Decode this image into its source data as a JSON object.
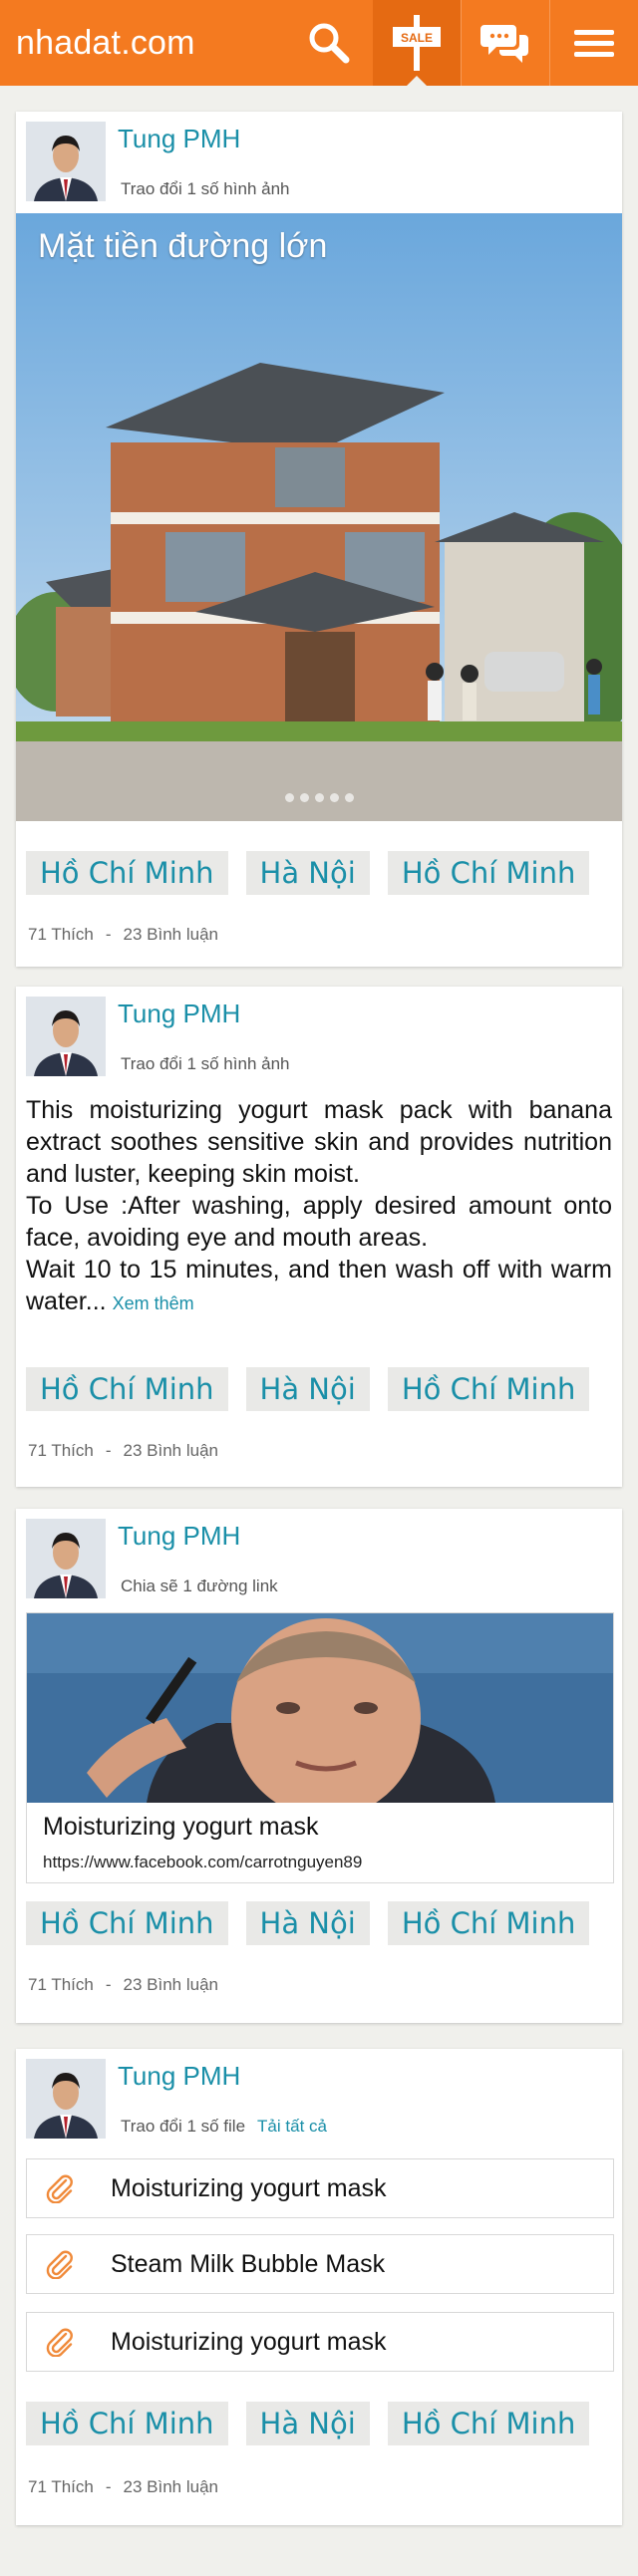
{
  "header": {
    "logo": "nhadat.com",
    "sale_badge": "SALE"
  },
  "colors": {
    "brand": "#f47a20",
    "accent": "#1a8fa8"
  },
  "icons": [
    "search-icon",
    "sale-sign-icon",
    "chat-icon",
    "menu-icon",
    "paperclip-icon"
  ],
  "posts": [
    {
      "author": "Tung PMH",
      "subtitle": "Trao đổi 1 số hình ảnh",
      "hero_title": "Mặt tiền đường lớn",
      "slides": 5,
      "tags": [
        "Hồ Chí Minh",
        "Hà Nội",
        "Hồ Chí Minh"
      ],
      "likes": "71 Thích",
      "separator": "-",
      "comments": "23 Bình luận"
    },
    {
      "author": "Tung PMH",
      "subtitle": "Trao đổi 1 số hình ảnh",
      "body": "This moisturizing yogurt mask pack with banana extract soothes sensitive skin and provides nutrition and luster, keeping skin moist.\nTo Use :After washing, apply desired amount onto face, avoiding eye and mouth areas.\nWait 10 to 15 minutes, and then wash off with warm water...",
      "more": "Xem thêm",
      "tags": [
        "Hồ Chí Minh",
        "Hà Nội",
        "Hồ Chí Minh"
      ],
      "likes": "71 Thích",
      "separator": "-",
      "comments": "23 Bình luận"
    },
    {
      "author": "Tung PMH",
      "subtitle": "Chia sẽ 1 đường link",
      "link_title": "Moisturizing yogurt mask",
      "link_url": "https://www.facebook.com/carrotnguyen89",
      "tags": [
        "Hồ Chí Minh",
        "Hà Nội",
        "Hồ Chí Minh"
      ],
      "likes": "71 Thích",
      "separator": "-",
      "comments": "23 Bình luận"
    },
    {
      "author": "Tung PMH",
      "subtitle": "Trao đổi 1 số file",
      "download_all": "Tải tất cả",
      "files": [
        "Moisturizing yogurt mask",
        "Steam Milk Bubble Mask",
        "Moisturizing yogurt mask"
      ],
      "tags": [
        "Hồ Chí Minh",
        "Hà Nội",
        "Hồ Chí Minh"
      ],
      "likes": "71 Thích",
      "separator": "-",
      "comments": "23 Bình luận"
    }
  ]
}
